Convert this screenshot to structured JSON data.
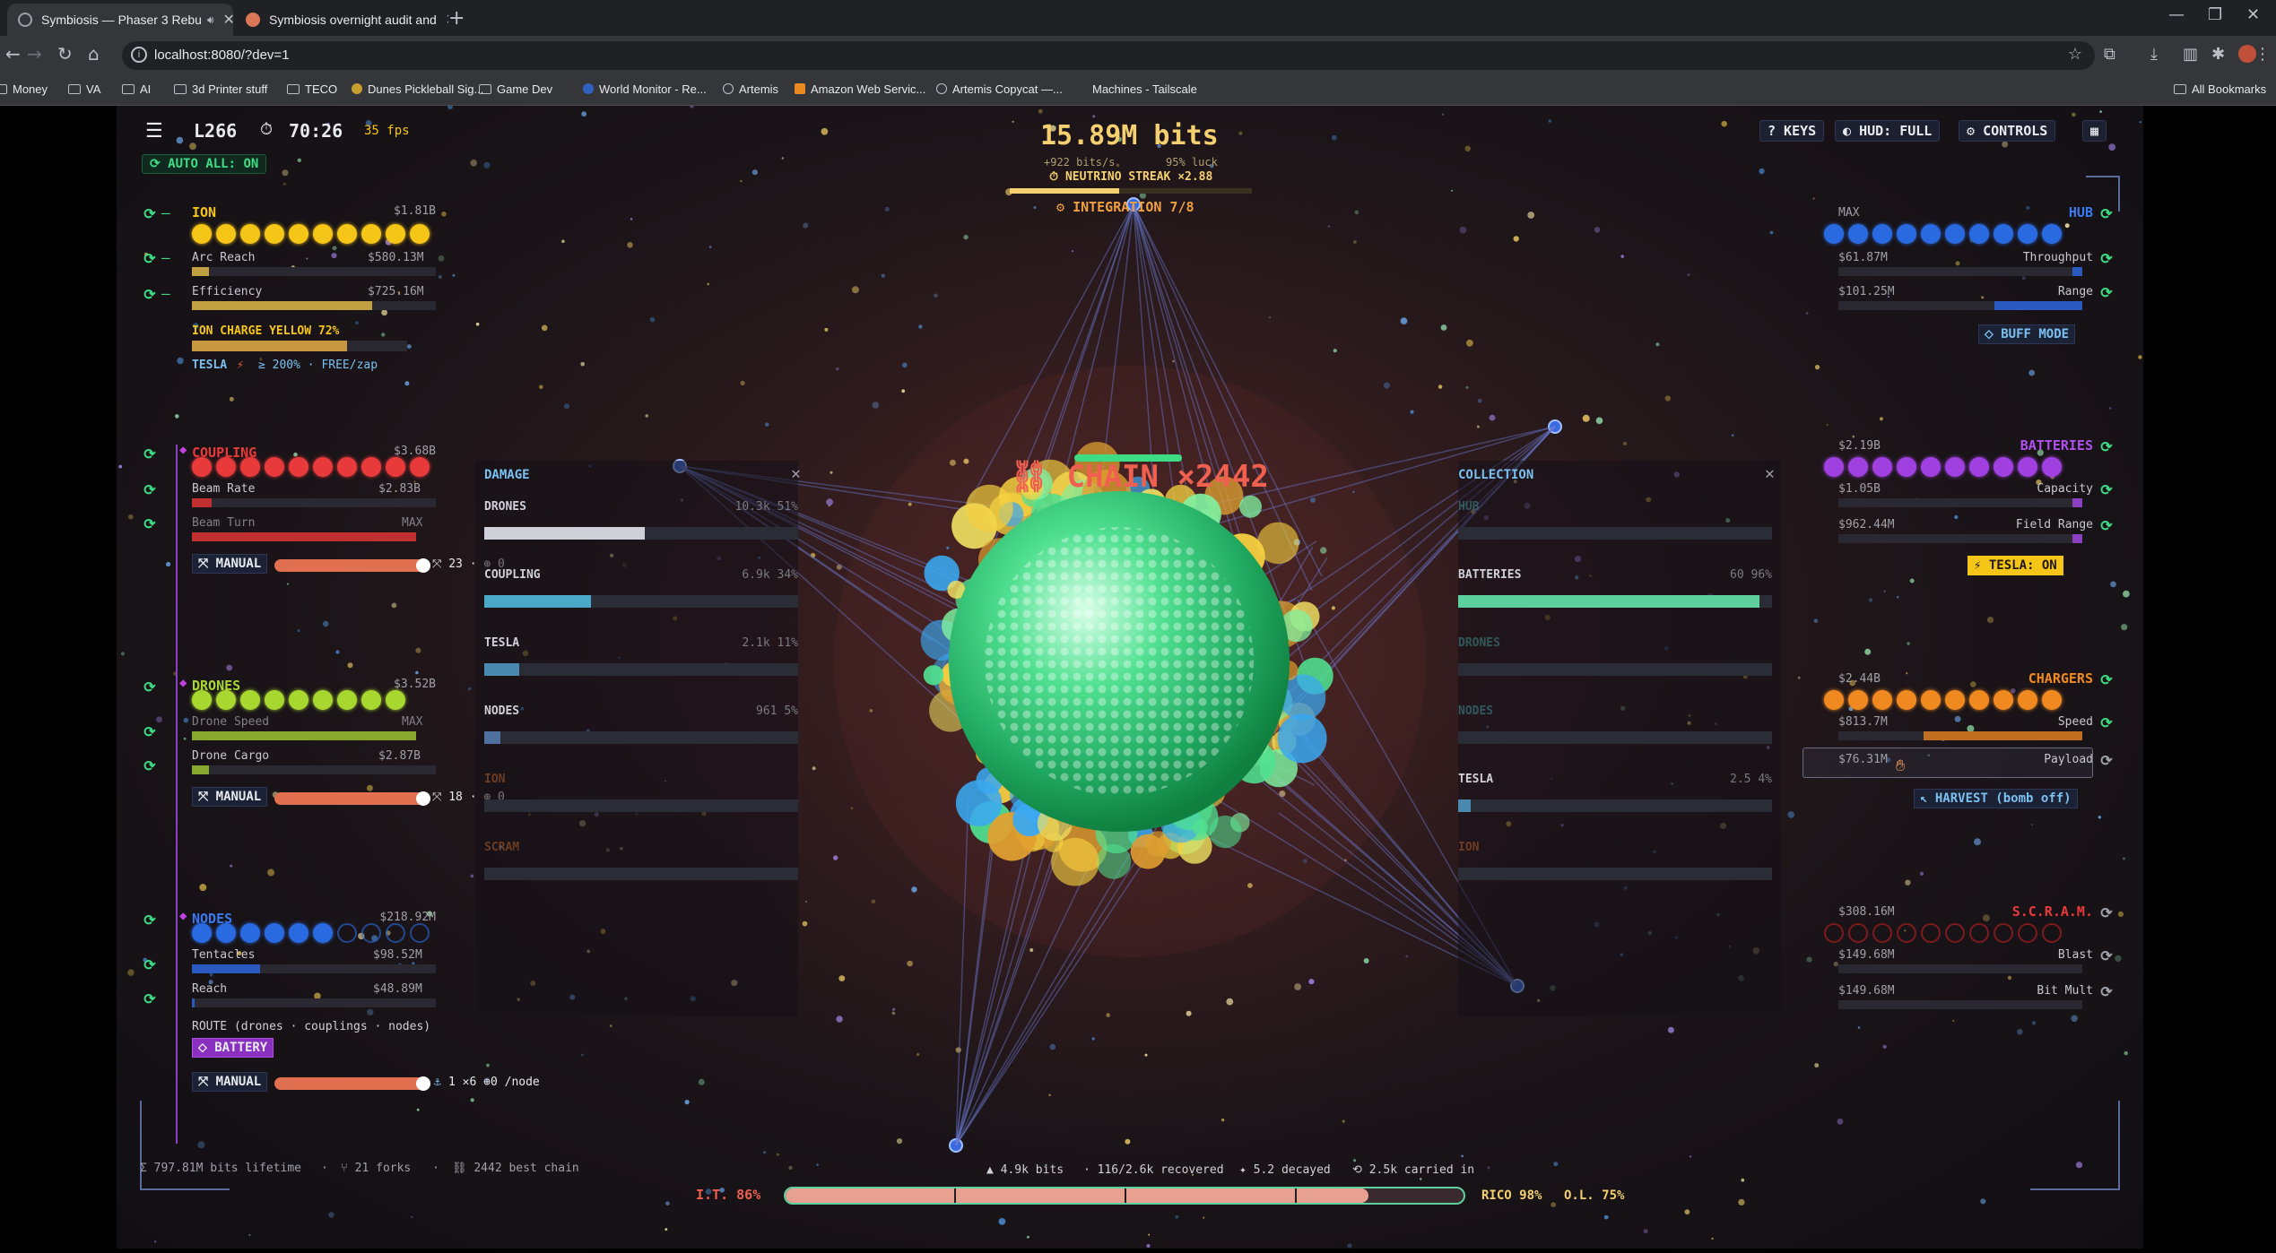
{
  "browser": {
    "tabs": [
      {
        "title": "Symbiosis — Phaser 3 Rebu",
        "active": true
      },
      {
        "title": "Symbiosis overnight audit and",
        "active": false
      }
    ],
    "url": "localhost:8080/?dev=1",
    "bookmarks": [
      "Money",
      "VA",
      "AI",
      "3d Printer stuff",
      "TECO",
      "Dunes Pickleball Sig...",
      "Game Dev",
      "World Monitor - Re...",
      "Artemis",
      "Amazon Web Servic...",
      "Artemis Copycat —...",
      "Machines - Tailscale"
    ],
    "all_bookmarks": "All Bookmarks"
  },
  "hud": {
    "level": "L266",
    "timer": "70:26",
    "fps": "35 fps",
    "auto_all": "AUTO ALL: ON",
    "bits": "15.89M bits",
    "rate": "+922 bits/s",
    "luck": "95% luck",
    "neutrino_streak": "NEUTRINO STREAK ×2.88",
    "integration": "INTEGRATION 7/8",
    "keys": "? KEYS",
    "hud_mode": "HUD: FULL",
    "controls": "CONTROLS",
    "chain": "CHAIN ×2442"
  },
  "left": {
    "ion": {
      "name": "ION",
      "cost": "$1.81B",
      "dots_filled": 10,
      "dots_total": 10,
      "rows": [
        {
          "label": "Arc Reach",
          "value": "$580.13M",
          "fill": 0.07
        },
        {
          "label": "Efficiency",
          "value": "$725.16M",
          "fill": 0.74
        }
      ],
      "charge": "ION CHARGE  YELLOW  72%",
      "charge_fill": 0.72,
      "tesla": "TESLA",
      "tesla_note": "≥ 200% · FREE/zap"
    },
    "coupling": {
      "name": "COUPLING",
      "cost": "$3.68B",
      "dots_filled": 10,
      "dots_total": 10,
      "rows": [
        {
          "label": "Beam Rate",
          "value": "$2.83B",
          "fill": 0.08
        },
        {
          "label": "Beam Turn",
          "value": "MAX",
          "fill": 1
        }
      ],
      "manual": "MANUAL",
      "slider_fill": 0.8,
      "slider_value": "23",
      "slider_extra": "0"
    },
    "drones": {
      "name": "DRONES",
      "cost": "$3.52B",
      "dots_filled": 9,
      "dots_total": 9,
      "rows": [
        {
          "label": "Drone Speed",
          "value": "MAX",
          "fill": 1
        },
        {
          "label": "Drone Cargo",
          "value": "$2.87B",
          "fill": 0.07
        }
      ],
      "manual": "MANUAL",
      "slider_fill": 0.8,
      "slider_value": "18",
      "slider_extra": "0"
    },
    "nodes": {
      "name": "NODES",
      "cost": "$218.92M",
      "dots_filled": 6,
      "dots_total": 10,
      "rows": [
        {
          "label": "Tentacles",
          "value": "$98.52M",
          "fill": 0.3
        },
        {
          "label": "Reach",
          "value": "$48.89M",
          "fill": 0.01
        }
      ],
      "route": "ROUTE  (drones · couplings · nodes)",
      "battery": "BATTERY",
      "manual": "MANUAL",
      "slider_fill": 0.8,
      "slider_note": "1 ✕6 ⊕0 /node"
    }
  },
  "right": {
    "hub": {
      "name": "HUB",
      "cost": "MAX",
      "dots_filled": 10,
      "dots_total": 10,
      "rows": [
        {
          "label": "Throughput",
          "value": "$61.87M",
          "fill": 0.06
        },
        {
          "label": "Range",
          "value": "$101.25M",
          "fill": 0.5
        }
      ],
      "mode": "BUFF MODE"
    },
    "batteries": {
      "name": "BATTERIES",
      "cost": "$2.19B",
      "dots_filled": 10,
      "dots_total": 10,
      "rows": [
        {
          "label": "Capacity",
          "value": "$1.05B",
          "fill": 0.05
        },
        {
          "label": "Field Range",
          "value": "$962.44M",
          "fill": 0.05
        }
      ],
      "tesla": "TESLA: ON"
    },
    "chargers": {
      "name": "CHARGERS",
      "cost": "$2.44B",
      "dots_filled": 10,
      "dots_total": 10,
      "rows": [
        {
          "label": "Speed",
          "value": "$813.7M",
          "fill": 0.65
        },
        {
          "label": "Payload",
          "value": "$76.31M",
          "fill": 0
        }
      ],
      "harvest": "HARVEST (bomb off)"
    },
    "scram": {
      "name": "S.C.R.A.M.",
      "cost": "$308.16M",
      "dots_filled": 0,
      "dots_total": 10,
      "rows": [
        {
          "label": "Blast",
          "value": "$149.68M",
          "fill": 0
        },
        {
          "label": "Bit Mult",
          "value": "$149.68M",
          "fill": 0
        }
      ]
    }
  },
  "damage": {
    "title": "DAMAGE",
    "rows": [
      {
        "label": "DRONES",
        "value": "10.3k  51%",
        "fill": 0.51,
        "color": "#d0d0d8"
      },
      {
        "label": "COUPLING",
        "value": "6.9k  34%",
        "fill": 0.34,
        "color": "#4aa8c8"
      },
      {
        "label": "TESLA",
        "value": "2.1k  11%",
        "fill": 0.11,
        "color": "#4a8ab0"
      },
      {
        "label": "NODES",
        "value": "961  5%",
        "fill": 0.05,
        "color": "#5070a0"
      },
      {
        "label": "ION",
        "value": "",
        "fill": 0,
        "color": "#d07030"
      },
      {
        "label": "SCRAM",
        "value": "",
        "fill": 0,
        "color": "#d07030"
      }
    ]
  },
  "collection": {
    "title": "COLLECTION",
    "rows": [
      {
        "label": "HUB",
        "value": "",
        "fill": 0,
        "color": "#4aa"
      },
      {
        "label": "BATTERIES",
        "value": "60  96%",
        "fill": 0.96,
        "color": "#5ed0a0"
      },
      {
        "label": "DRONES",
        "value": "",
        "fill": 0,
        "color": "#4aa"
      },
      {
        "label": "NODES",
        "value": "",
        "fill": 0,
        "color": "#4aa"
      },
      {
        "label": "TESLA",
        "value": "2.5  4%",
        "fill": 0.04,
        "color": "#4a8ab0"
      },
      {
        "label": "ION",
        "value": "",
        "fill": 0,
        "color": "#d07030"
      }
    ]
  },
  "footer": {
    "lifetime": "Σ 797.81M bits lifetime",
    "forks": "21 forks",
    "best_chain": "2442 best chain",
    "bits_stat": "▲ 4.9k bits",
    "recovered": "116/2.6k recovered",
    "decayed": "5.2 decayed",
    "carried": "2.5k carried in",
    "it_label": "I.T. 86%",
    "rico": "RICO 98%",
    "ol": "O.L. 75%",
    "progress": 0.86
  },
  "colors": {
    "ion": "#f5c518",
    "coupling": "#e83a3a",
    "drones": "#a8d830",
    "nodes": "#2a6ae0",
    "hub": "#2a6ae0",
    "batteries": "#a040e0",
    "chargers": "#f08a20",
    "scram": "#c02020",
    "accent": "#3ddc84"
  }
}
